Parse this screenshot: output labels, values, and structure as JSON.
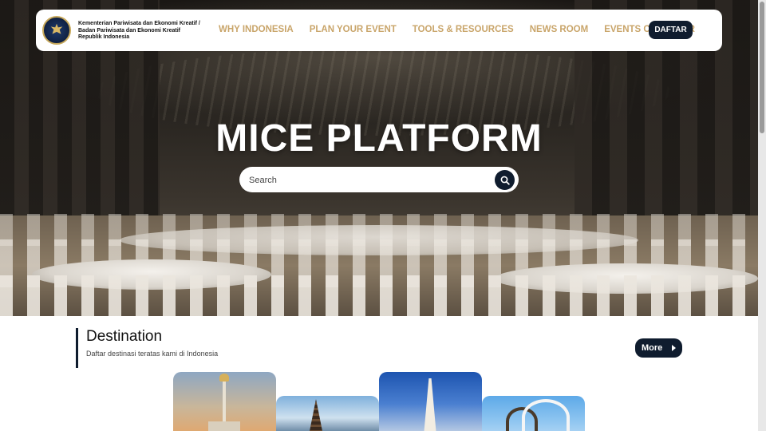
{
  "nav": {
    "org_line1": "Kementerian Pariwisata dan Ekonomi Kreatif /",
    "org_line2": "Badan Pariwisata dan Ekonomi Kreatif",
    "org_line3": "Republik Indonesia",
    "items": [
      {
        "label": "WHY INDONESIA"
      },
      {
        "label": "PLAN YOUR EVENT"
      },
      {
        "label": "TOOLS & RESOURCES"
      },
      {
        "label": "NEWS ROOM"
      },
      {
        "label": "EVENTS CALENDAR"
      }
    ],
    "cta_label": "DAFTAR"
  },
  "hero": {
    "title": "MICE PLATFORM",
    "search": {
      "placeholder": "Search",
      "value": ""
    }
  },
  "destination": {
    "title": "Destination",
    "subtitle": "Daftar destinasi teratas kami di Indonesia",
    "more_label": "More"
  },
  "colors": {
    "primary": "#0f1c2e",
    "nav_link": "#c9a56a",
    "logo_ring": "#c7a85a"
  },
  "icons": [
    "garuda-logo-icon",
    "search-icon",
    "chevron-right-icon"
  ]
}
